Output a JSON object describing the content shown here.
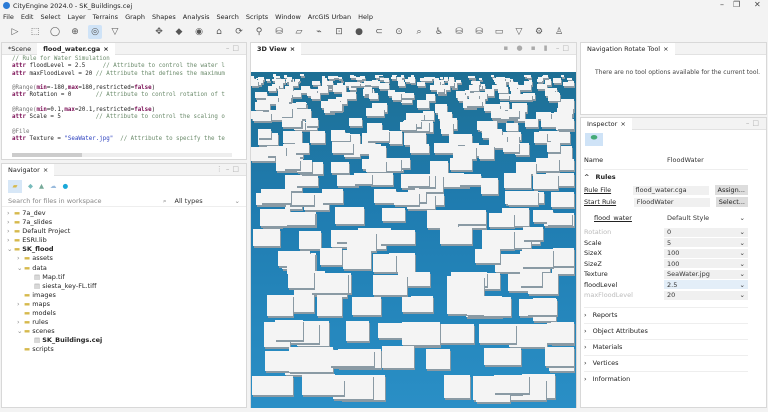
{
  "window": {
    "title": "CityEngine 2024.0 - SK_Buildings.cej",
    "controls": [
      "–",
      "❐",
      "✕"
    ]
  },
  "menu": [
    "File",
    "Edit",
    "Select",
    "Layer",
    "Terrains",
    "Graph",
    "Shapes",
    "Analysis",
    "Search",
    "Scripts",
    "Window",
    "ArcGIS Urban",
    "Help"
  ],
  "toolbar": [
    "select-icon",
    "frame-icon",
    "pan-icon",
    "zoom-icon",
    "rotate-icon",
    "view-icon",
    "move-icon",
    "scale-icon",
    "target-icon"
  ],
  "editor": {
    "tabs": [
      "*Scene",
      "flood_water.cga"
    ],
    "lines": [
      [
        [
          "cm",
          "// Rule for Water Simulation"
        ]
      ],
      [
        [
          "kw",
          "attr "
        ],
        [
          "",
          "floodLevel = 2.5     "
        ],
        [
          "cm",
          "// Attribute to control the water l"
        ]
      ],
      [
        [
          "kw",
          "attr "
        ],
        [
          "",
          "maxFloodLevel = 20 "
        ],
        [
          "cm",
          "// Attribute that defines the maximum"
        ]
      ],
      [
        [
          "",
          ""
        ]
      ],
      [
        [
          "an",
          "@Range("
        ],
        [
          "kw",
          "min"
        ],
        [
          "",
          "=-180,"
        ],
        [
          "kw",
          "max"
        ],
        [
          "",
          "=180,restricted="
        ],
        [
          "kw",
          "false"
        ],
        [
          "",
          ")"
        ]
      ],
      [
        [
          "kw",
          "attr "
        ],
        [
          "",
          "Rotation = 0       "
        ],
        [
          "cm",
          "// Attribute to control rotation of t"
        ]
      ],
      [
        [
          "",
          ""
        ]
      ],
      [
        [
          "an",
          "@Range("
        ],
        [
          "kw",
          "min"
        ],
        [
          "",
          "=0.1,"
        ],
        [
          "kw",
          "max"
        ],
        [
          "",
          "=20.1,restricted="
        ],
        [
          "kw",
          "false"
        ],
        [
          "",
          ")"
        ]
      ],
      [
        [
          "kw",
          "attr "
        ],
        [
          "",
          "Scale = 5          "
        ],
        [
          "cm",
          "// Attribute to control the scaling o"
        ]
      ],
      [
        [
          "",
          ""
        ]
      ],
      [
        [
          "an",
          "@File"
        ]
      ],
      [
        [
          "kw",
          "attr "
        ],
        [
          "",
          "Texture = "
        ],
        [
          "st",
          "\"SeaWater.jpg\""
        ],
        [
          "cm",
          "  // Attribute to specify the te"
        ]
      ]
    ]
  },
  "navigator": {
    "title": "Navigator",
    "search_placeholder": "Search for files in workspace",
    "filter": "All types",
    "tree": [
      {
        "label": "7a_dev",
        "depth": 0,
        "arrow": "›"
      },
      {
        "label": "7a_slides",
        "depth": 0,
        "arrow": "›"
      },
      {
        "label": "Default Project",
        "depth": 0,
        "arrow": "›"
      },
      {
        "label": "ESRI.lib",
        "depth": 0,
        "arrow": "›"
      },
      {
        "label": "SK_flood",
        "depth": 0,
        "arrow": "⌄",
        "bold": true
      },
      {
        "label": "assets",
        "depth": 1,
        "arrow": "›"
      },
      {
        "label": "data",
        "depth": 1,
        "arrow": "⌄"
      },
      {
        "label": "Map.tif",
        "depth": 2,
        "arrow": "",
        "file": true
      },
      {
        "label": "siesta_key-FL.tiff",
        "depth": 2,
        "arrow": "",
        "file": true
      },
      {
        "label": "images",
        "depth": 1,
        "arrow": ""
      },
      {
        "label": "maps",
        "depth": 1,
        "arrow": "›"
      },
      {
        "label": "models",
        "depth": 1,
        "arrow": ""
      },
      {
        "label": "rules",
        "depth": 1,
        "arrow": "›"
      },
      {
        "label": "scenes",
        "depth": 1,
        "arrow": "⌄"
      },
      {
        "label": "SK_Buildings.cej",
        "depth": 2,
        "arrow": "",
        "file": true,
        "bold": true
      },
      {
        "label": "scripts",
        "depth": 1,
        "arrow": ""
      }
    ]
  },
  "view3d": {
    "title": "3D View"
  },
  "navtool": {
    "title": "Navigation Rotate Tool",
    "message": "There are no tool options available for the current tool."
  },
  "inspector": {
    "title": "Inspector",
    "name_label": "Name",
    "name_value": "FloodWater",
    "rules_label": "Rules",
    "rule_file_label": "Rule File",
    "rule_file": "flood_water.cga",
    "assign": "Assign...",
    "start_rule_label": "Start Rule",
    "start_rule": "FloodWater",
    "select": "Select...",
    "group": "flood_water",
    "style": "Default Style",
    "attrs": [
      {
        "label": "Rotation",
        "value": "0",
        "dim": true
      },
      {
        "label": "Scale",
        "value": "5"
      },
      {
        "label": "SizeX",
        "value": "100"
      },
      {
        "label": "SizeZ",
        "value": "100"
      },
      {
        "label": "Texture",
        "value": "SeaWater.jpg"
      },
      {
        "label": "floodLevel",
        "value": "2.5",
        "active": true
      },
      {
        "label": "maxFloodLevel",
        "value": "20",
        "dim": true
      }
    ],
    "sections": [
      "Reports",
      "Object Attributes",
      "Materials",
      "Vertices",
      "Information"
    ]
  }
}
